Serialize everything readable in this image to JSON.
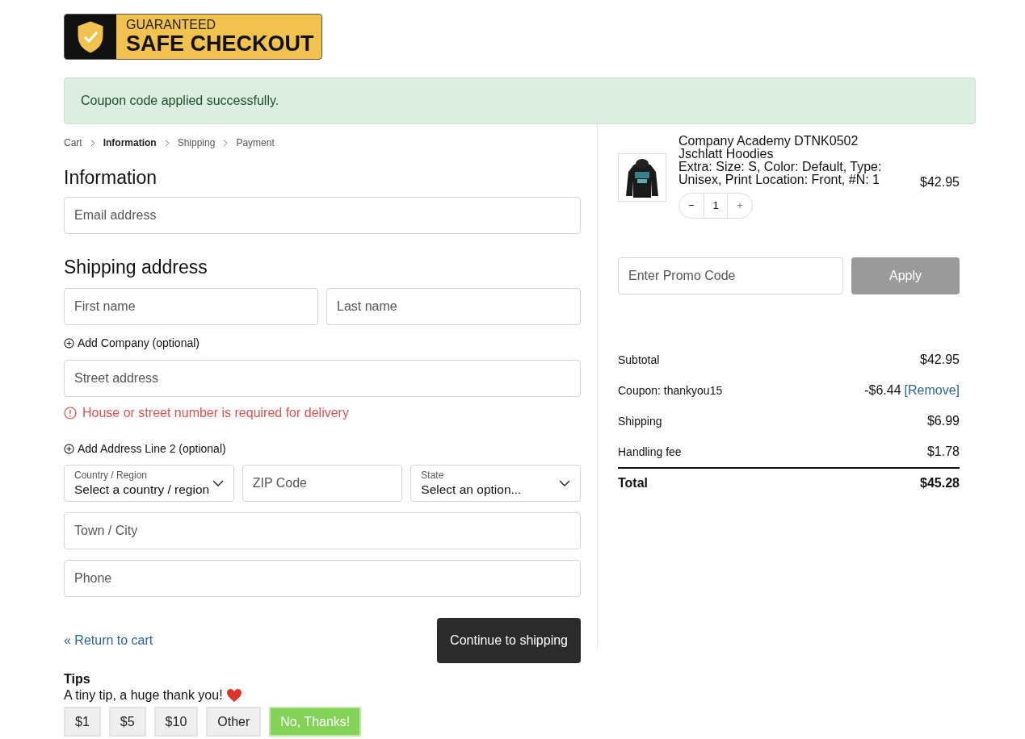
{
  "badge": {
    "top": "GUARANTEED",
    "bottom": "SAFE CHECKOUT"
  },
  "notice": "Coupon code applied successfully.",
  "breadcrumbs": [
    {
      "label": "Cart",
      "selected": false
    },
    {
      "label": "Information",
      "selected": true
    },
    {
      "label": "Shipping",
      "selected": false
    },
    {
      "label": "Payment",
      "selected": false
    }
  ],
  "information": {
    "title": "Information",
    "email": {
      "placeholder": "Email address"
    }
  },
  "shipping_address": {
    "title": "Shipping address",
    "first_name": {
      "placeholder": "First name"
    },
    "last_name": {
      "placeholder": "Last name"
    },
    "add_company": "Add Company (optional)",
    "street": {
      "placeholder": "Street address",
      "error": "House or street number is required for delivery"
    },
    "add_line2": "Add Address Line 2 (optional)",
    "country": {
      "label": "Country / Region",
      "value": "Select a country / region"
    },
    "zip": {
      "placeholder": "ZIP Code"
    },
    "state": {
      "label": "State",
      "value": "Select an option..."
    },
    "town": {
      "placeholder": "Town / City"
    },
    "phone": {
      "placeholder": "Phone"
    }
  },
  "return_link": "« Return to cart",
  "continue_button": "Continue to shipping",
  "tips": {
    "title": "Tips",
    "message": "A tiny tip, a huge thank you!",
    "options": [
      {
        "label": "$1",
        "selected": false
      },
      {
        "label": "$5",
        "selected": false
      },
      {
        "label": "$10",
        "selected": false
      },
      {
        "label": "Other",
        "selected": false
      },
      {
        "label": "No, Thanks!",
        "selected": true
      }
    ]
  },
  "cart_item": {
    "name": "Company Academy DTNK0502 Jschlatt Hoodies",
    "details": "Extra: Size: S, Color: Default, Type: Unisex, Print Location: Front, #N: 1",
    "price": "$42.95",
    "quantity": "1",
    "minus": "−",
    "plus": "+"
  },
  "promo": {
    "placeholder": "Enter Promo Code",
    "button": "Apply"
  },
  "totals": [
    {
      "label": "Subtotal",
      "value": "$42.95"
    },
    {
      "label": "Coupon: thankyou15",
      "value": "-$6.44",
      "link": "[Remove]"
    },
    {
      "label": "Shipping",
      "value": "$6.99"
    },
    {
      "label": "Handling fee",
      "value": "$1.78"
    }
  ],
  "total": {
    "label": "Total",
    "value": "$45.28"
  }
}
